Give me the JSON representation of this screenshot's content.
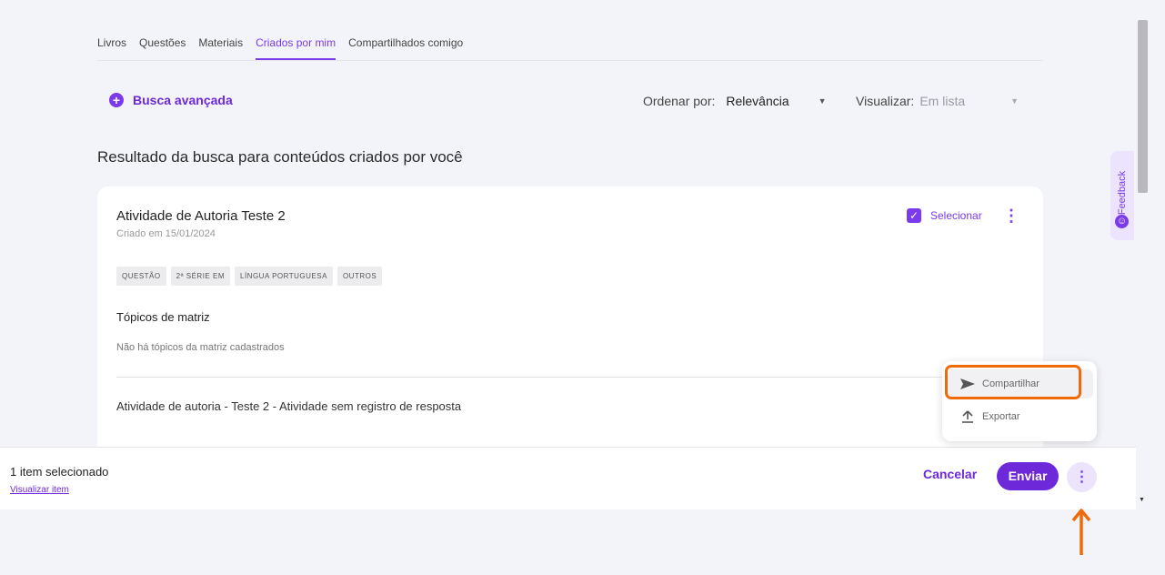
{
  "tabs": [
    "Livros",
    "Questões",
    "Materiais",
    "Criados por mim",
    "Compartilhados comigo"
  ],
  "toolbar": {
    "advanced_search": "Busca avançada",
    "sort_label": "Ordenar por:",
    "sort_value": "Relevância",
    "view_label": "Visualizar:",
    "view_value": "Em lista"
  },
  "results_title": "Resultado da busca para conteúdos criados por você",
  "card": {
    "title": "Atividade de Autoria Teste 2",
    "date": "Criado em 15/01/2024",
    "select_label": "Selecionar",
    "tags": [
      "QUESTÃO",
      "2ª SÉRIE EM",
      "LÍNGUA PORTUGUESA",
      "OUTROS"
    ],
    "topics_title": "Tópicos de matriz",
    "topics_empty": "Não há tópicos da matriz cadastrados",
    "activity_text": "Atividade de autoria - Teste 2 - Atividade sem registro de resposta"
  },
  "menu": {
    "share": "Compartilhar",
    "export": "Exportar"
  },
  "feedback_label": "Feedback",
  "bottom_bar": {
    "selected_count": "1 item selecionado",
    "view_item": "Visualizar item",
    "cancel": "Cancelar",
    "send": "Enviar"
  },
  "colors": {
    "accent": "#7c3aed",
    "accent_dark": "#6d28d9",
    "highlight": "#f06a0a",
    "background": "#f3f4f9"
  },
  "icons": [
    "plus-icon",
    "check-icon",
    "kebab-icon",
    "send-icon",
    "upload-icon",
    "smile-icon",
    "up-arrow-annotation"
  ]
}
